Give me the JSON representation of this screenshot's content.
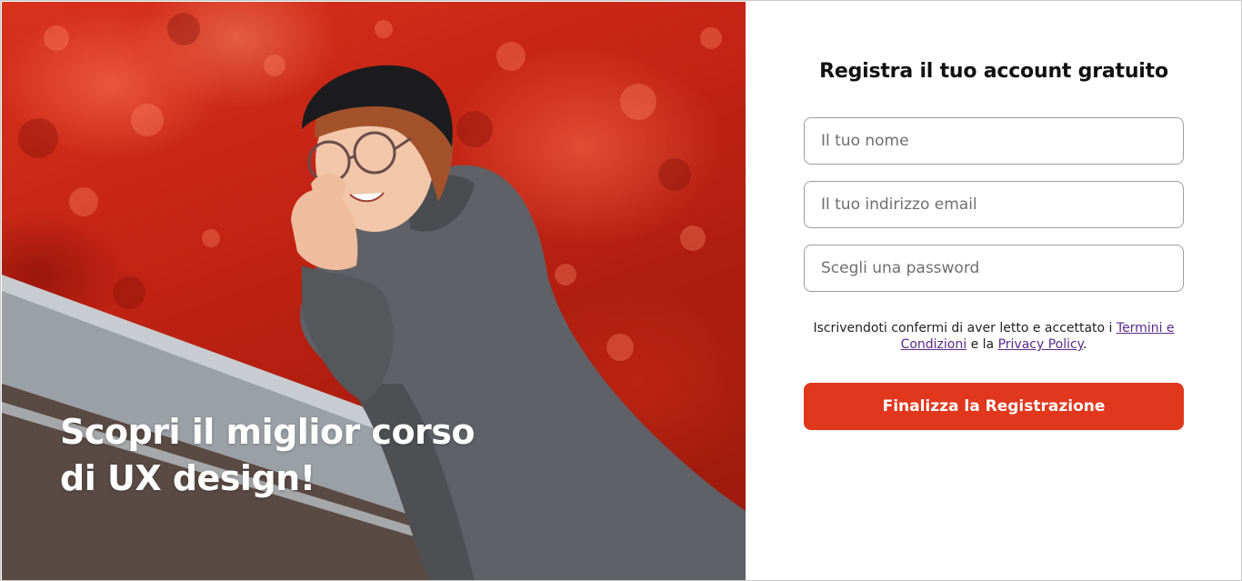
{
  "hero": {
    "heading_line1": "Scopri il miglior corso",
    "heading_line2": "di UX design!",
    "image_subject": "smiling woman with glasses and black beret in grey coat leaning on railing, red autumn foliage background"
  },
  "form": {
    "title": "Registra il tuo account gratuito",
    "name_placeholder": "Il tuo nome",
    "email_placeholder": "Il tuo indirizzo email",
    "password_placeholder": "Scegli una password",
    "consent_prefix": "Iscrivendoti confermi di aver letto e accettato i ",
    "terms_link": "Termini e Condizioni",
    "consent_middle": " e la ",
    "privacy_link": "Privacy Policy",
    "consent_suffix": ".",
    "submit_label": "Finalizza la Registrazione"
  },
  "colors": {
    "accent": "#e0371d",
    "link": "#5a2a8a",
    "hero_bg": "#c42415"
  }
}
